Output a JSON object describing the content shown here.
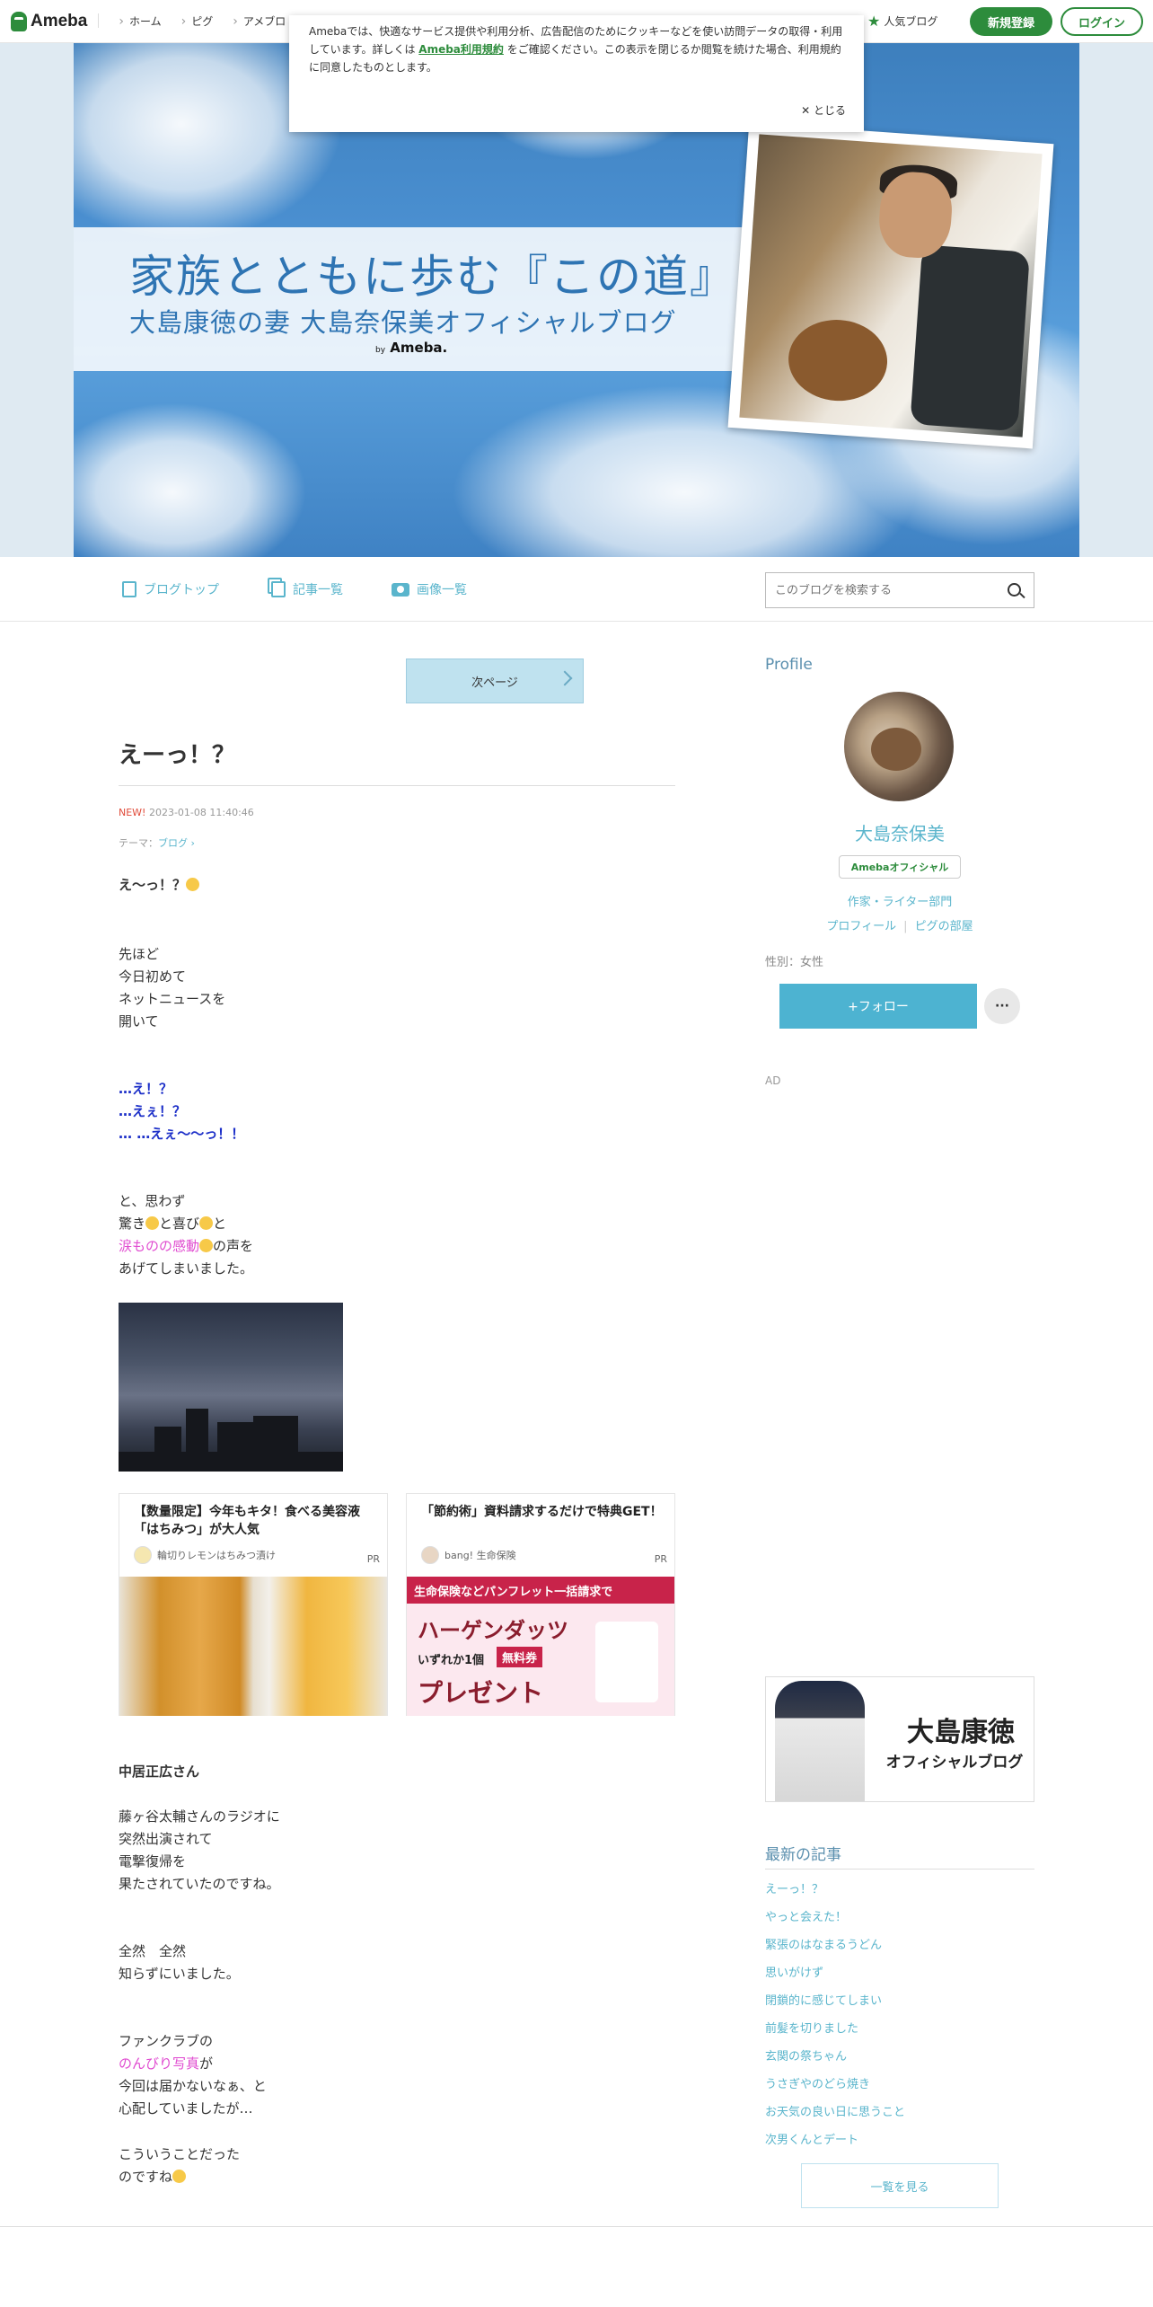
{
  "topbar": {
    "logo_text": "Ameba",
    "nav": [
      "ホーム",
      "ピグ",
      "アメブロ"
    ],
    "popular": "人気ブログ",
    "register": "新規登録",
    "login": "ログイン"
  },
  "cookie": {
    "text_before": "Amebaでは、快適なサービス提供や利用分析、広告配信のためにクッキーなどを使い訪問データの取得・利用しています。詳しくは",
    "link": "Ameba利用規約",
    "text_after": "をご確認ください。この表示を閉じるか閲覧を続けた場合、利用規約に同意したものとします。",
    "close": "とじる"
  },
  "header": {
    "title_line1": "家族とともに歩む『この道』",
    "title_line2": "大島康徳の妻 大島奈保美オフィシャルブログ",
    "by": "by",
    "ameba": "Ameba."
  },
  "blognav": {
    "top": "ブログトップ",
    "list": "記事一覧",
    "images": "画像一覧",
    "search_placeholder": "このブログを検索する"
  },
  "entry": {
    "next_page": "次ページ",
    "title": "えーっ！？",
    "new_badge": "NEW!",
    "datetime": "2023-01-08 11:40:46",
    "theme_label": "テーマ：",
    "theme": "ブログ",
    "p1": "え〜っ！？",
    "p2": [
      "先ほど",
      "今日初めて",
      "ネットニュースを",
      "開いて"
    ],
    "p3": [
      "…え！？",
      "…えぇ！？",
      "… …えぇ〜〜っ！！"
    ],
    "p4_1": "と、思わず",
    "p4_2a": "驚き",
    "p4_2b": "と喜び",
    "p4_2c": "と",
    "p4_3a": "涙ものの感動",
    "p4_3b": "の声を",
    "p4_4": "あげてしまいました。",
    "p5": [
      "中居正広さん"
    ],
    "p6": [
      "藤ヶ谷太輔さんのラジオに",
      "突然出演されて",
      "電撃復帰を",
      "果たされていたのですね。"
    ],
    "p7": [
      "全然　全然",
      "知らずにいました。"
    ],
    "p8_1": "ファンクラブの",
    "p8_2a": "のんびり写真",
    "p8_2b": "が",
    "p8_3": "今回は届かないなぁ、と",
    "p8_4": "心配していましたが…",
    "p9_1": "こういうことだった",
    "p9_2": "のですね"
  },
  "ads": [
    {
      "title": "【数量限定】今年もキタ！食べる美容液「はちみつ」が大人気",
      "source": "輪切りレモンはちみつ漬け",
      "pr": "PR"
    },
    {
      "title": "「節約術」資料請求するだけで特典GET！",
      "source": "bang! 生命保険",
      "pr": "PR",
      "banner_top": "生命保険などパンフレット一括請求で",
      "banner_brand": "ハーゲンダッツ",
      "banner_sub": "いずれか1個",
      "banner_free": "無料券",
      "banner_present": "プレゼント"
    }
  ],
  "sidebar": {
    "profile_heading": "Profile",
    "name": "大島奈保美",
    "official": "Amebaオフィシャル",
    "category": "作家・ライター部門",
    "profile_link": "プロフィール",
    "pigg_link": "ピグの部屋",
    "gender": "性別：女性",
    "follow": "+フォロー",
    "more": "···",
    "ad": "AD",
    "banner_line1": "大島康徳",
    "banner_line2": "オフィシャルブログ",
    "latest_heading": "最新の記事",
    "latest": [
      "えーっ！？",
      "やっと会えた！",
      "緊張のはなまるうどん",
      "思いがけず",
      "閉鎖的に感じてしまい",
      "前髪を切りました",
      "玄関の祭ちゃん",
      "うさぎやのどら焼き",
      "お天気の良い日に思うこと",
      "次男くんとデート"
    ],
    "see_all": "一覧を見る"
  }
}
